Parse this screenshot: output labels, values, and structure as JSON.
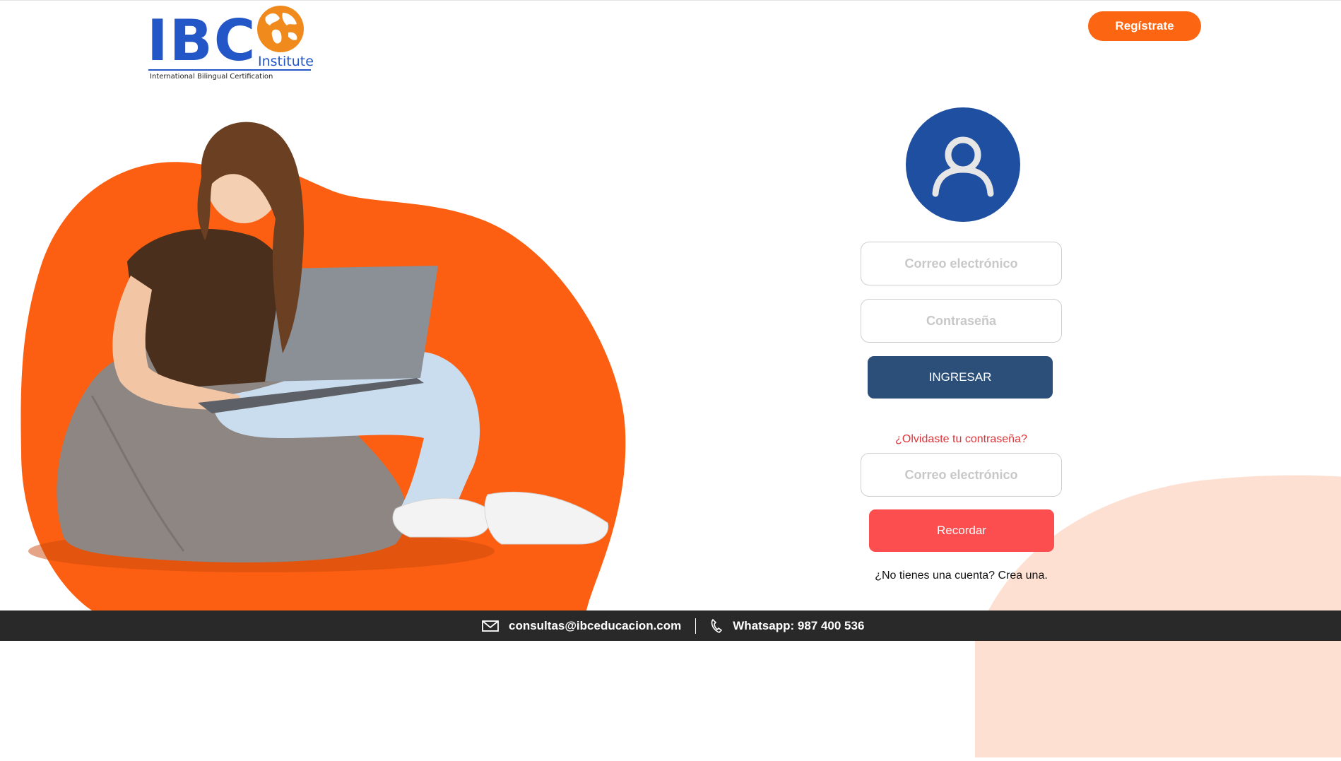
{
  "header": {
    "logo": {
      "letters": "IBC",
      "institute": "Institute",
      "subtitle": "International Bilingual Certification"
    },
    "register_label": "Regístrate"
  },
  "icons": {
    "user": "user-icon",
    "mail": "mail-icon",
    "phone": "phone-icon",
    "globe": "globe-icon"
  },
  "colors": {
    "brand_blue": "#2356c7",
    "avatar_blue": "#1f4fa0",
    "orange": "#fc6512",
    "login_button": "#2c4f79",
    "remind_button": "#fc4d4f",
    "forgot_link": "#e0343a",
    "footer_bg": "#292929",
    "peach": "#fde0d2"
  },
  "login": {
    "email_placeholder": "Correo electrónico",
    "password_placeholder": "Contraseña",
    "submit_label": "INGRESAR",
    "forgot_label": "¿Olvidaste tu contraseña?",
    "reset_email_placeholder": "Correo electrónico",
    "remind_label": "Recordar",
    "signup_text": "¿No tienes una cuenta? Crea una."
  },
  "footer": {
    "email": "consultas@ibceducacion.com",
    "whatsapp": "Whatsapp: 987 400 536"
  }
}
